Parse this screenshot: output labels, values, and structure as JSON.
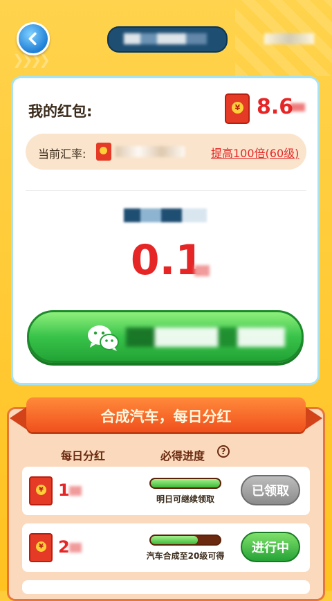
{
  "header": {
    "back_icon": "back-arrow-icon"
  },
  "wallet": {
    "label": "我的红包:",
    "balance": "8.6",
    "rate_label": "当前汇率:",
    "rate_link": "提高100倍(60级)"
  },
  "withdraw": {
    "amount": "0.1",
    "button_icon": "wechat-icon"
  },
  "dividend": {
    "banner": "合成汽车，每日分红",
    "col_daily": "每日分红",
    "col_progress": "必得进度",
    "help_glyph": "?",
    "rows": [
      {
        "value": "1",
        "progress": 1.0,
        "progress_text": "明日可继续领取",
        "action": "已领取",
        "action_state": "claimed"
      },
      {
        "value": "2",
        "progress": 0.68,
        "progress_text": "汽车合成至20级可得",
        "action": "进行中",
        "action_state": "progress"
      }
    ]
  },
  "colors": {
    "background": "#ffc21f",
    "accent_red": "#e62626",
    "button_green": "#39c34a",
    "panel_orange": "#f0501d"
  }
}
